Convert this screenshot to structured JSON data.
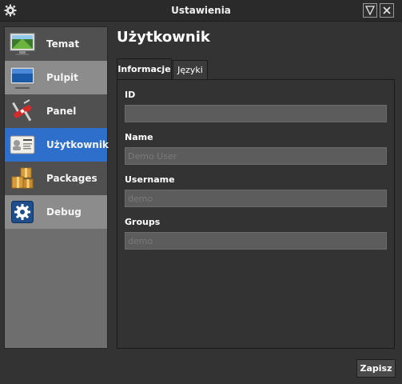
{
  "window": {
    "title": "Ustawienia",
    "minimize_symbol": "∇",
    "close_symbol": "✕"
  },
  "sidebar": {
    "items": [
      {
        "label": "Temat",
        "icon": "theme-icon"
      },
      {
        "label": "Pulpit",
        "icon": "monitor-icon"
      },
      {
        "label": "Panel",
        "icon": "swiss-knife-icon"
      },
      {
        "label": "Użytkownik",
        "icon": "user-card-icon"
      },
      {
        "label": "Packages",
        "icon": "packages-icon"
      },
      {
        "label": "Debug",
        "icon": "gear-icon"
      }
    ],
    "active_index": 3
  },
  "main": {
    "title": "Użytkownik",
    "tabs": [
      {
        "label": "Informacje",
        "active": true
      },
      {
        "label": "Języki",
        "active": false
      }
    ],
    "fields": {
      "id": {
        "label": "ID",
        "value": ""
      },
      "name": {
        "label": "Name",
        "value": "Demo User"
      },
      "username": {
        "label": "Username",
        "value": "demo"
      },
      "groups": {
        "label": "Groups",
        "value": "demo"
      }
    }
  },
  "footer": {
    "save_label": "Zapisz"
  },
  "colors": {
    "active_item": "#2e6fcc",
    "background": "#333333",
    "input_background": "#5c5c5c"
  }
}
